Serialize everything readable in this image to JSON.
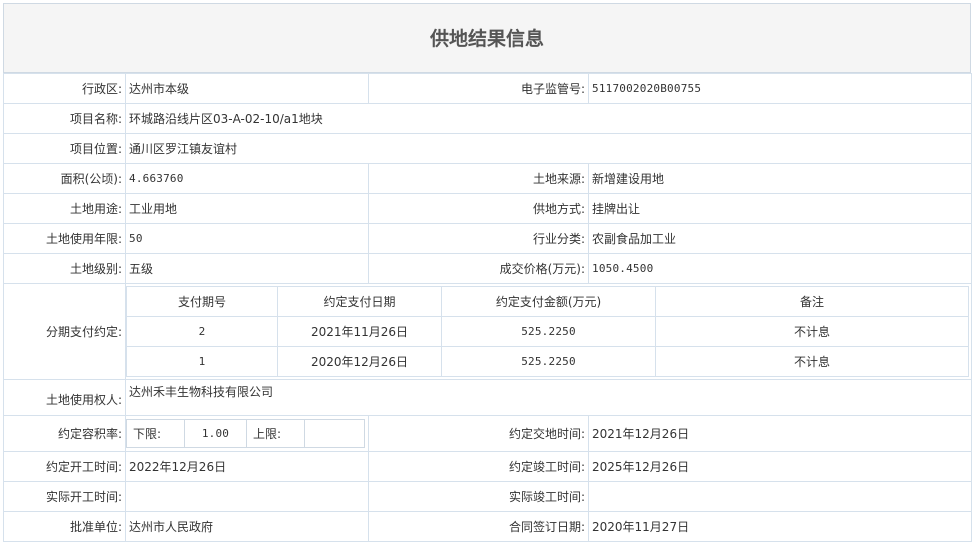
{
  "title": "供地结果信息",
  "fields": {
    "admin_region": {
      "label": "行政区:",
      "value": "达州市本级"
    },
    "supervision_no": {
      "label": "电子监管号:",
      "value": "5117002020B00755"
    },
    "project_name": {
      "label": "项目名称:",
      "value": "环城路沿线片区03-A-02-10/a1地块"
    },
    "project_location": {
      "label": "项目位置:",
      "value": "通川区罗江镇友谊村"
    },
    "area": {
      "label": "面积(公顷):",
      "value": "4.663760"
    },
    "land_source": {
      "label": "土地来源:",
      "value": "新增建设用地"
    },
    "land_use": {
      "label": "土地用途:",
      "value": "工业用地"
    },
    "supply_method": {
      "label": "供地方式:",
      "value": "挂牌出让"
    },
    "use_term": {
      "label": "土地使用年限:",
      "value": "50"
    },
    "industry": {
      "label": "行业分类:",
      "value": "农副食品加工业"
    },
    "land_grade": {
      "label": "土地级别:",
      "value": "五级"
    },
    "deal_price": {
      "label": "成交价格(万元):",
      "value": "1050.4500"
    },
    "installment": {
      "label": "分期支付约定:"
    },
    "land_user": {
      "label": "土地使用权人:",
      "value": "达州禾丰生物科技有限公司"
    },
    "far": {
      "label": "约定容积率:",
      "lower_label": "下限:",
      "lower_value": "1.00",
      "upper_label": "上限:",
      "upper_value": ""
    },
    "handover_time": {
      "label": "约定交地时间:",
      "value": "2021年12月26日"
    },
    "start_time": {
      "label": "约定开工时间:",
      "value": "2022年12月26日"
    },
    "completion_time": {
      "label": "约定竣工时间:",
      "value": "2025年12月26日"
    },
    "actual_start": {
      "label": "实际开工时间:",
      "value": ""
    },
    "actual_completion": {
      "label": "实际竣工时间:",
      "value": ""
    },
    "approval_unit": {
      "label": "批准单位:",
      "value": "达州市人民政府"
    },
    "contract_date": {
      "label": "合同签订日期:",
      "value": "2020年11月27日"
    }
  },
  "payments": {
    "headers": [
      "支付期号",
      "约定支付日期",
      "约定支付金额(万元)",
      "备注"
    ],
    "rows": [
      [
        "2",
        "2021年11月26日",
        "525.2250",
        "不计息"
      ],
      [
        "1",
        "2020年12月26日",
        "525.2250",
        "不计息"
      ]
    ]
  }
}
